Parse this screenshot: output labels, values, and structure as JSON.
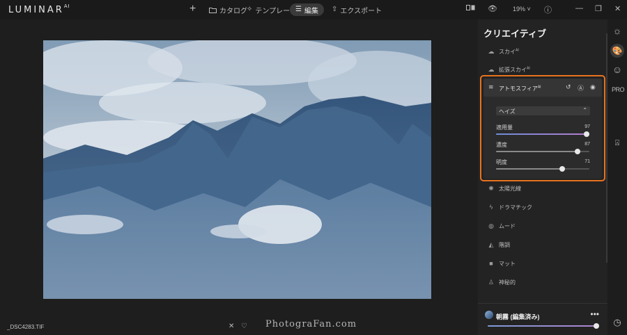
{
  "header": {
    "logo": "LUMINAR",
    "logo_sup": "AI",
    "nav": [
      {
        "label": "カタログ",
        "icon": "folder-icon"
      },
      {
        "label": "テンプレート",
        "icon": "sparkle-icon"
      },
      {
        "label": "編集",
        "icon": "sliders-icon"
      },
      {
        "label": "エクスポート",
        "icon": "share-icon"
      }
    ],
    "zoom": "19%"
  },
  "panel": {
    "title": "クリエイティブ",
    "tools_top": [
      {
        "label": "スカイ",
        "sup": "AI"
      },
      {
        "label": "拡張スカイ",
        "sup": "AI"
      }
    ],
    "atmosphere": {
      "title": "アトモスフィア",
      "title_sup": "AI",
      "type_select": "ヘイズ",
      "sliders": [
        {
          "label": "適用量",
          "value": "97",
          "fraction": 0.97,
          "accent": true
        },
        {
          "label": "濃度",
          "value": "87",
          "fraction": 0.87,
          "accent": false
        },
        {
          "label": "明度",
          "value": "71",
          "fraction": 0.71,
          "accent": false
        }
      ]
    },
    "tools_bottom": [
      {
        "label": "太陽光線",
        "icon": "sun-rays-icon"
      },
      {
        "label": "ドラマチック",
        "icon": "lightning-icon"
      },
      {
        "label": "ムード",
        "icon": "mood-icon"
      },
      {
        "label": "階調",
        "icon": "toning-icon"
      },
      {
        "label": "マット",
        "icon": "matte-icon"
      },
      {
        "label": "神秘的",
        "icon": "mystical-icon"
      }
    ]
  },
  "preset": {
    "name": "朝霧 (編集済み)",
    "amount_fraction": 1.0
  },
  "footer": {
    "filename": "_DSC4283.TIF",
    "watermark": "PhotograFan.com"
  },
  "colors": {
    "accent_outline": "#e8731f",
    "background": "#1e1e1e"
  }
}
